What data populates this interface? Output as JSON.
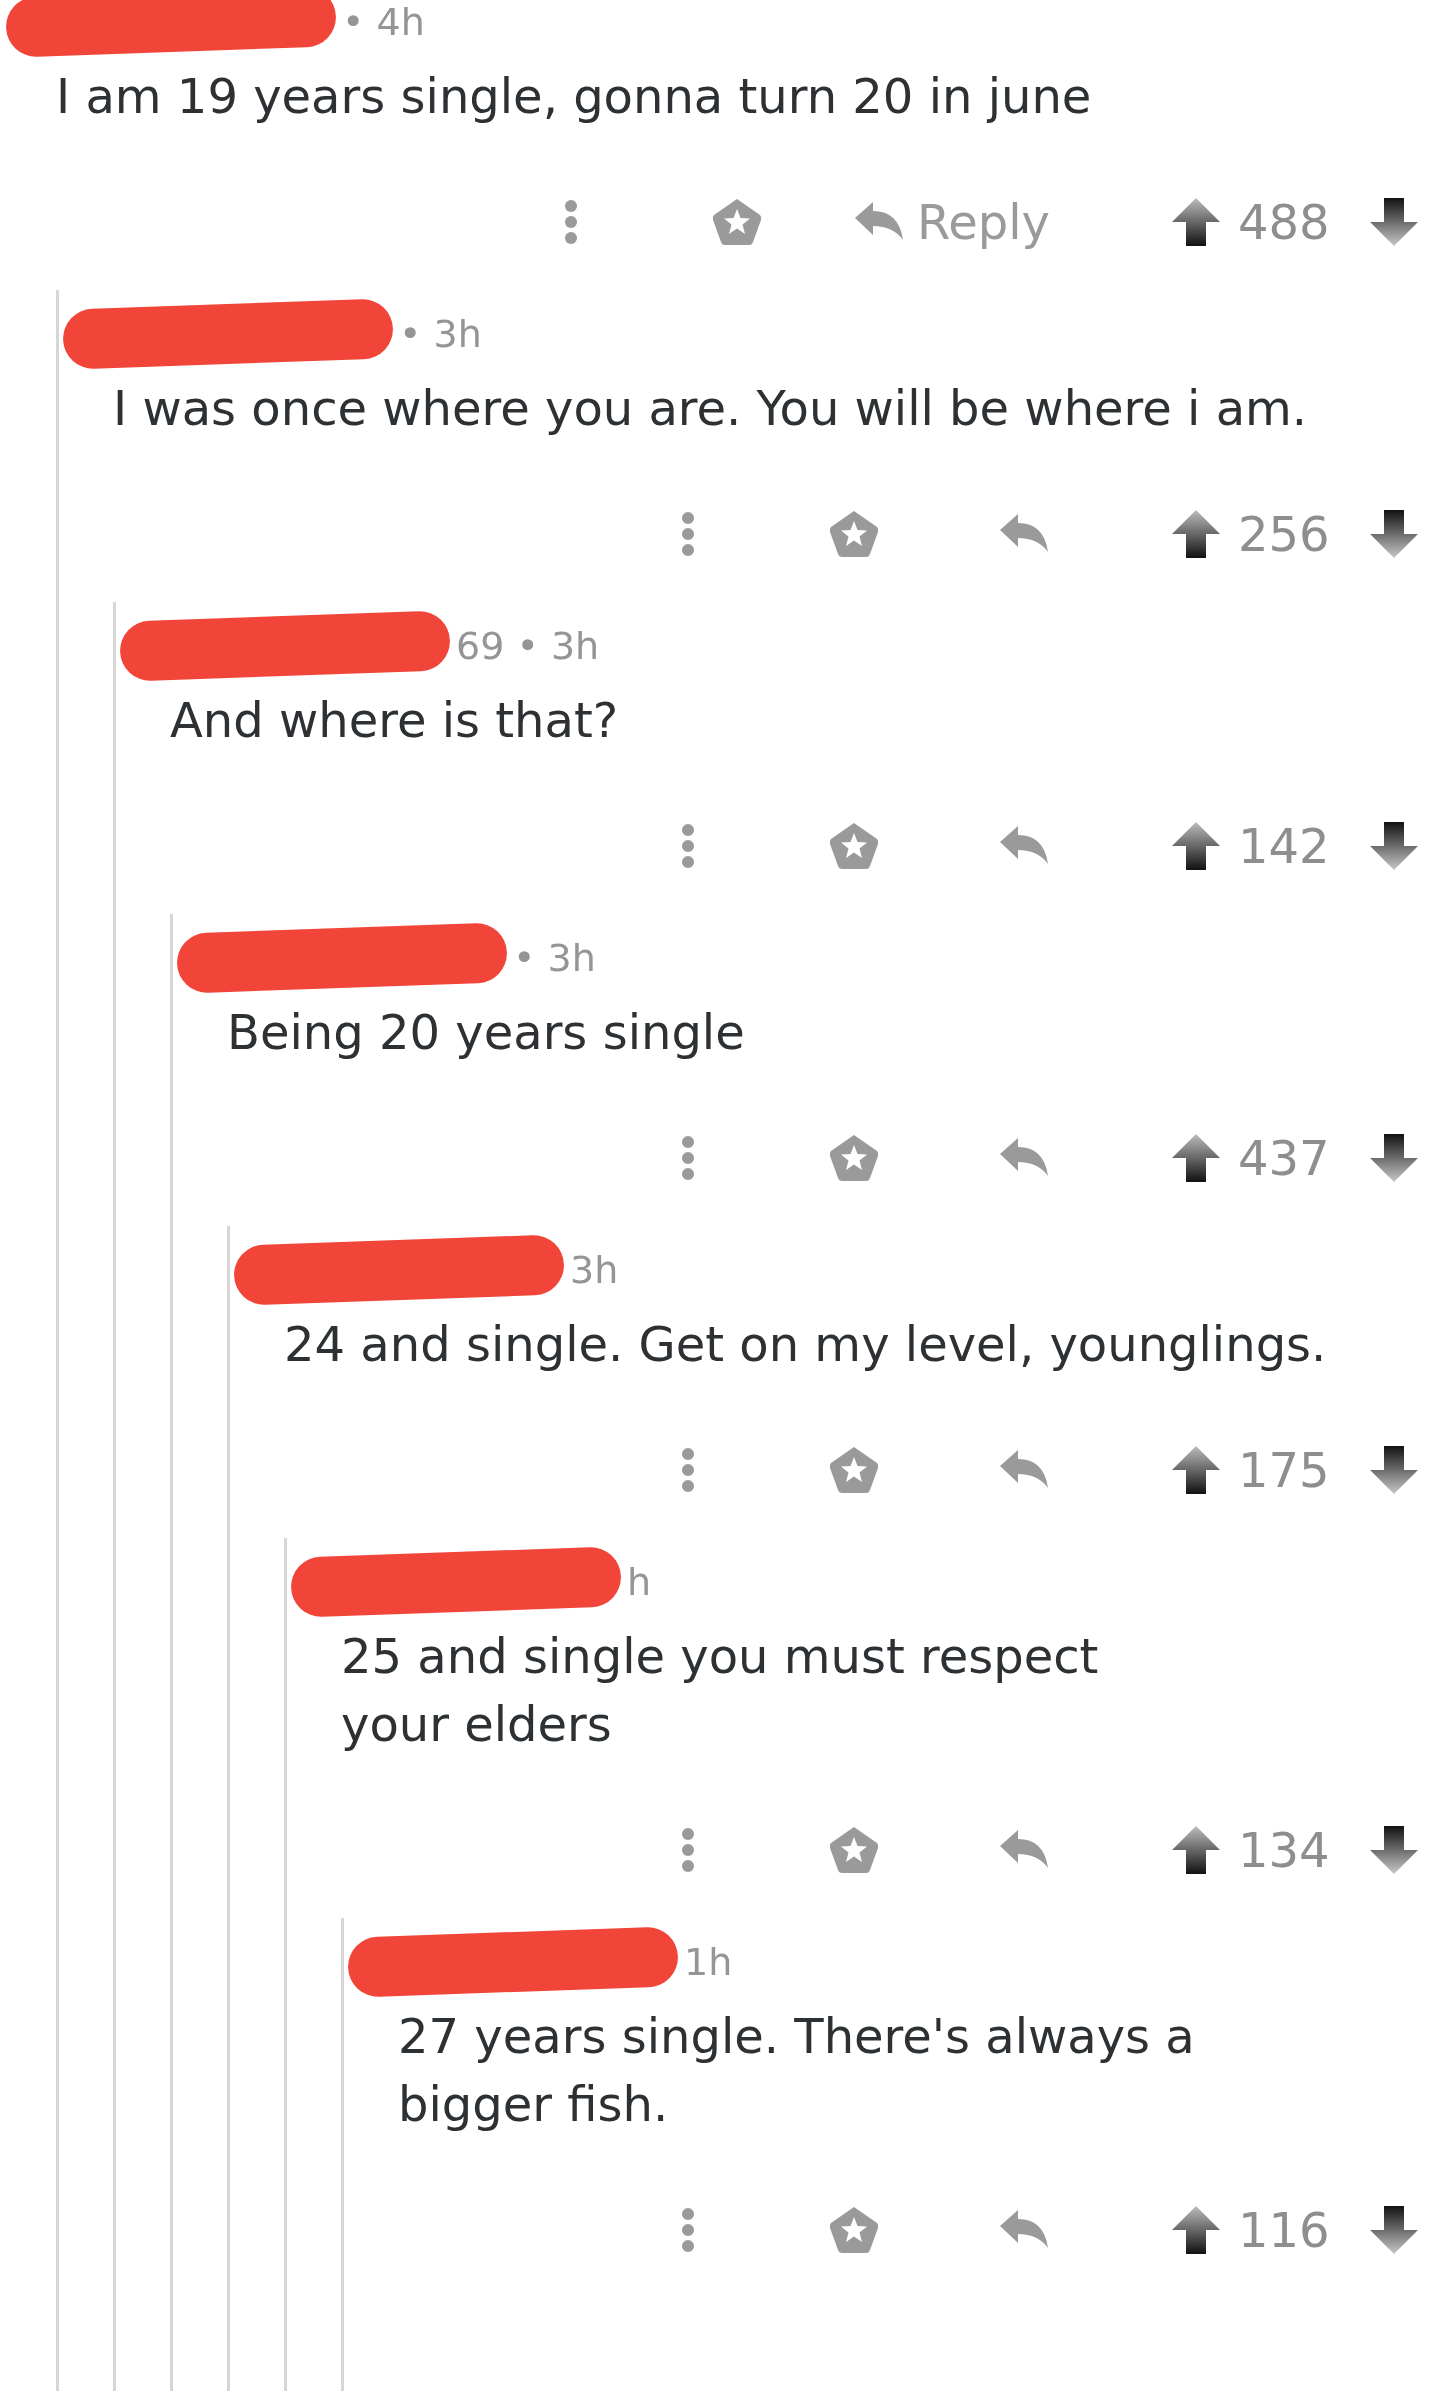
{
  "comments": [
    {
      "meta": "• 4h",
      "body": "I am 19 years single, gonna turn 20 in june",
      "reply_label": "Reply",
      "score": "488",
      "children": [
        {
          "meta": "• 3h",
          "body": "I was once where you are. You will be where i am.",
          "score": "256",
          "children": [
            {
              "meta": "69 • 3h",
              "body": "And where is that?",
              "score": "142",
              "children": [
                {
                  "meta": "• 3h",
                  "body": "Being 20 years single",
                  "score": "437",
                  "children": [
                    {
                      "meta": "3h",
                      "body": "24 and single. Get on my level, younglings.",
                      "score": "175",
                      "children": [
                        {
                          "meta": "h",
                          "body": "25 and single you must respect\nyour elders",
                          "score": "134",
                          "children": [
                            {
                              "meta": "1h",
                              "body": "27 years single. There's always a\nbigger fish.",
                              "score": "116"
                            }
                          ]
                        }
                      ]
                    }
                  ]
                }
              ]
            }
          ]
        }
      ]
    }
  ]
}
